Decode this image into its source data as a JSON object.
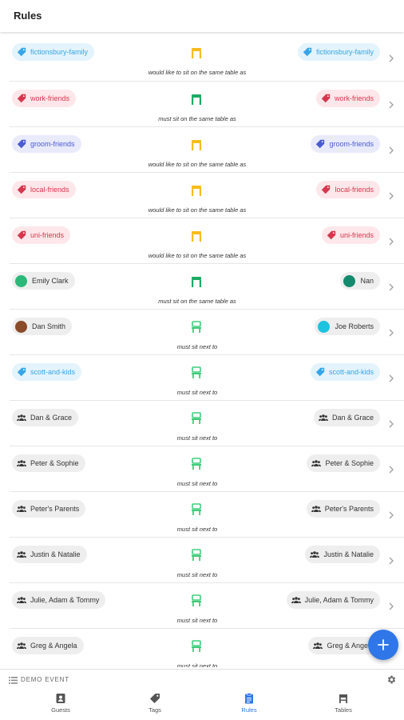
{
  "header": {
    "title": "Rules"
  },
  "colors": {
    "accent": "#2f76e8",
    "seat_preferred": "#f5bc1c",
    "seat_required": "#1dab64",
    "seat_next_to": "#3fcd7c",
    "tag_blue": "#36a6e8",
    "tag_red": "#d8364d",
    "tag_indigo": "#4b5bd3"
  },
  "rules": [
    {
      "left": {
        "kind": "tag",
        "label": "fictionsbury-family",
        "color": "blue"
      },
      "right": {
        "kind": "tag",
        "label": "fictionsbury-family",
        "color": "blue"
      },
      "relation": "would like to sit on the same table as",
      "seat_icon": "seat-preferred"
    },
    {
      "left": {
        "kind": "tag",
        "label": "work-friends",
        "color": "red"
      },
      "right": {
        "kind": "tag",
        "label": "work-friends",
        "color": "red"
      },
      "relation": "must sit on the same table as",
      "seat_icon": "seat-required"
    },
    {
      "left": {
        "kind": "tag",
        "label": "groom-friends",
        "color": "indigo"
      },
      "right": {
        "kind": "tag",
        "label": "groom-friends",
        "color": "indigo"
      },
      "relation": "would like to sit on the same table as",
      "seat_icon": "seat-preferred"
    },
    {
      "left": {
        "kind": "tag",
        "label": "local-friends",
        "color": "red"
      },
      "right": {
        "kind": "tag",
        "label": "local-friends",
        "color": "red"
      },
      "relation": "would like to sit on the same table as",
      "seat_icon": "seat-preferred"
    },
    {
      "left": {
        "kind": "tag",
        "label": "uni-friends",
        "color": "red"
      },
      "right": {
        "kind": "tag",
        "label": "uni-friends",
        "color": "red"
      },
      "relation": "would like to sit on the same table as",
      "seat_icon": "seat-preferred"
    },
    {
      "left": {
        "kind": "person",
        "label": "Emily Clark",
        "avatar_color": "#2db87a"
      },
      "right": {
        "kind": "person",
        "label": "Nan",
        "avatar_color": "#138a6e"
      },
      "relation": "must sit on the same table as",
      "seat_icon": "seat-required"
    },
    {
      "left": {
        "kind": "person",
        "label": "Dan Smith",
        "avatar_color": "#8a4b2a"
      },
      "right": {
        "kind": "person",
        "label": "Joe Roberts",
        "avatar_color": "#1ec3e0"
      },
      "relation": "must sit next to",
      "seat_icon": "seat-next-to"
    },
    {
      "left": {
        "kind": "tag",
        "label": "scott-and-kids",
        "color": "blue"
      },
      "right": {
        "kind": "tag",
        "label": "scott-and-kids",
        "color": "blue"
      },
      "relation": "must sit next to",
      "seat_icon": "seat-next-to"
    },
    {
      "left": {
        "kind": "group",
        "label": "Dan & Grace"
      },
      "right": {
        "kind": "group",
        "label": "Dan & Grace"
      },
      "relation": "must sit next to",
      "seat_icon": "seat-next-to"
    },
    {
      "left": {
        "kind": "group",
        "label": "Peter & Sophie"
      },
      "right": {
        "kind": "group",
        "label": "Peter & Sophie"
      },
      "relation": "must sit next to",
      "seat_icon": "seat-next-to"
    },
    {
      "left": {
        "kind": "group",
        "label": "Peter's Parents"
      },
      "right": {
        "kind": "group",
        "label": "Peter's Parents"
      },
      "relation": "must sit next to",
      "seat_icon": "seat-next-to"
    },
    {
      "left": {
        "kind": "group",
        "label": "Justin & Natalie"
      },
      "right": {
        "kind": "group",
        "label": "Justin & Natalie"
      },
      "relation": "must sit next to",
      "seat_icon": "seat-next-to"
    },
    {
      "left": {
        "kind": "group",
        "label": "Julie, Adam & Tommy"
      },
      "right": {
        "kind": "group",
        "label": "Julie, Adam & Tommy"
      },
      "relation": "must sit next to",
      "seat_icon": "seat-next-to"
    },
    {
      "left": {
        "kind": "group",
        "label": "Greg & Angela"
      },
      "right": {
        "kind": "group",
        "label": "Greg & Angela"
      },
      "relation": "must sit next to",
      "seat_icon": "seat-next-to"
    }
  ],
  "fab": {
    "icon": "plus-icon"
  },
  "event": {
    "name": "DEMO EVENT",
    "icon": "list-icon",
    "settings_icon": "gear-icon"
  },
  "nav": {
    "items": [
      {
        "label": "Guests",
        "icon": "guests-icon",
        "active": false
      },
      {
        "label": "Tags",
        "icon": "tag-icon",
        "active": false
      },
      {
        "label": "Rules",
        "icon": "rules-icon",
        "active": true
      },
      {
        "label": "Tables",
        "icon": "table-icon",
        "active": false
      }
    ]
  }
}
